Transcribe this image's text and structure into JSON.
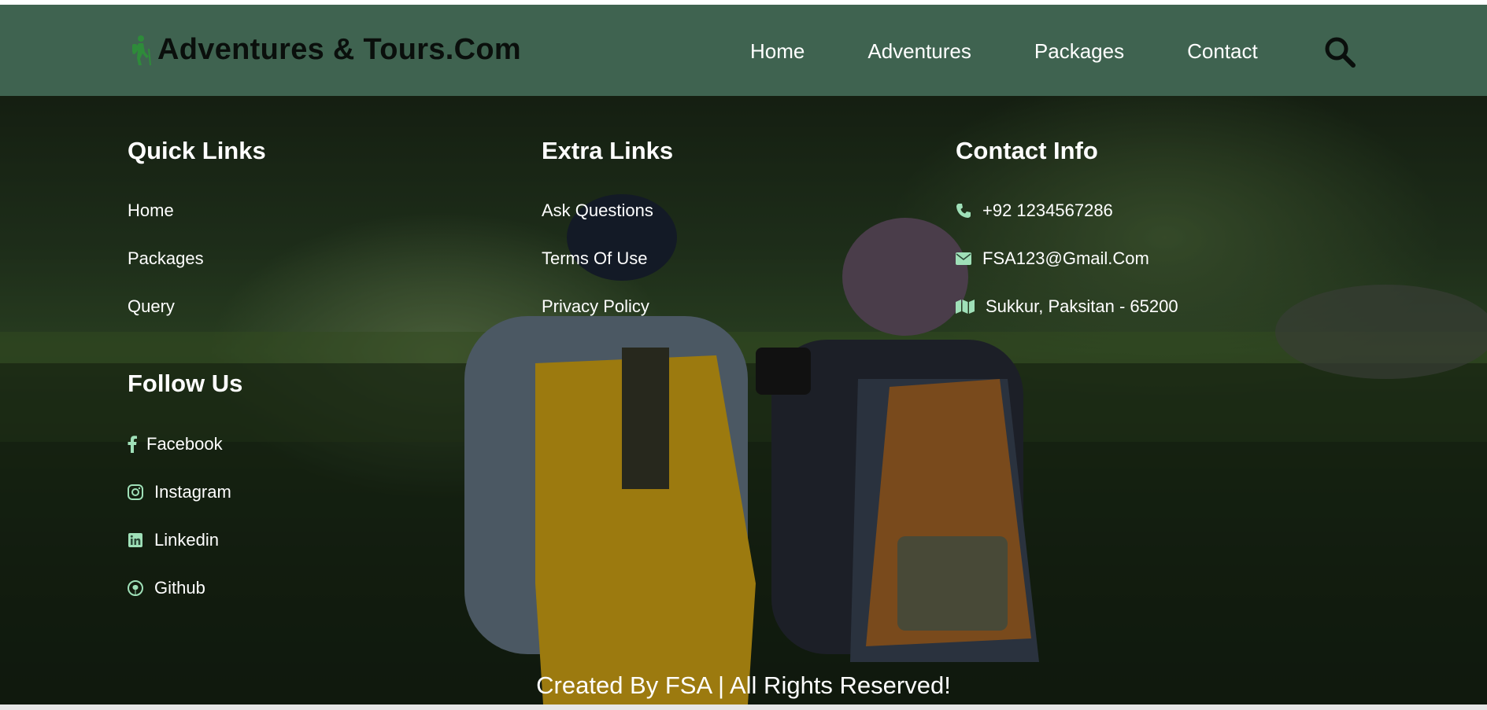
{
  "header": {
    "brand": "Adventures & Tours.Com",
    "brand_icon": "hiker-icon",
    "nav": [
      "Home",
      "Adventures",
      "Packages",
      "Contact"
    ],
    "search_icon": "search-icon"
  },
  "footer": {
    "quick_links": {
      "title": "Quick Links",
      "items": [
        "Home",
        "Packages",
        "Query"
      ]
    },
    "extra_links": {
      "title": "Extra Links",
      "items": [
        "Ask Questions",
        "Terms Of Use",
        "Privacy Policy"
      ]
    },
    "contact_info": {
      "title": "Contact Info",
      "items": [
        {
          "icon": "phone-icon",
          "text": "+92 1234567286"
        },
        {
          "icon": "envelope-icon",
          "text": "FSA123@Gmail.Com"
        },
        {
          "icon": "map-icon",
          "text": "Sukkur, Paksitan - 65200"
        }
      ]
    },
    "follow_us": {
      "title": "Follow Us",
      "items": [
        {
          "icon": "facebook-icon",
          "text": "Facebook"
        },
        {
          "icon": "instagram-icon",
          "text": "Instagram"
        },
        {
          "icon": "linkedin-icon",
          "text": "Linkedin"
        },
        {
          "icon": "github-icon",
          "text": "Github"
        }
      ]
    },
    "credits": "Created By FSA | All Rights Reserved!"
  },
  "colors": {
    "header_bg": "#3f6350",
    "brand_icon": "#2e8b3a",
    "text": "#ffffff"
  }
}
